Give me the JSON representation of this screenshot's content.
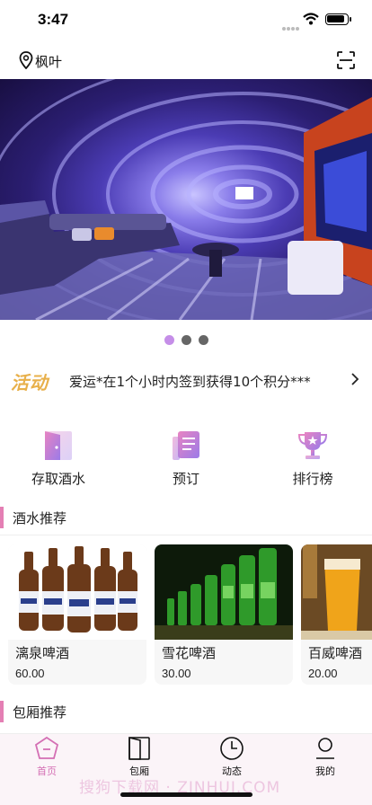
{
  "status_bar": {
    "time": "3:47"
  },
  "header": {
    "city": "枫叶",
    "location_icon": "location-pin-icon",
    "scan_icon": "scan-icon"
  },
  "banner": {
    "pages": 3,
    "active_page": 1
  },
  "activity": {
    "tag": "活动",
    "text": "爱运*在1个小时内签到获得10个积分***"
  },
  "quick_actions": [
    {
      "label": "存取酒水",
      "icon": "door-icon"
    },
    {
      "label": "预订",
      "icon": "document-icon"
    },
    {
      "label": "排行榜",
      "icon": "trophy-icon"
    }
  ],
  "sections": {
    "drinks": "酒水推荐",
    "rooms": "包厢推荐"
  },
  "products": [
    {
      "name": "漓泉啤酒",
      "price": "60.00"
    },
    {
      "name": "雪花啤酒",
      "price": "30.00"
    },
    {
      "name": "百威啤酒",
      "price": "20.00"
    }
  ],
  "tabbar": [
    {
      "label": "首页",
      "icon": "home-pentagon-icon"
    },
    {
      "label": "包厢",
      "icon": "door-icon"
    },
    {
      "label": "动态",
      "icon": "clock-icon"
    },
    {
      "label": "我的",
      "icon": "user-icon"
    }
  ],
  "watermark": "搜狗下载网 · ZINHUI.COM",
  "colors": {
    "accent": "#d46fb4",
    "activity_tag": "#e8b04a",
    "pager_active": "#c58ee8"
  }
}
